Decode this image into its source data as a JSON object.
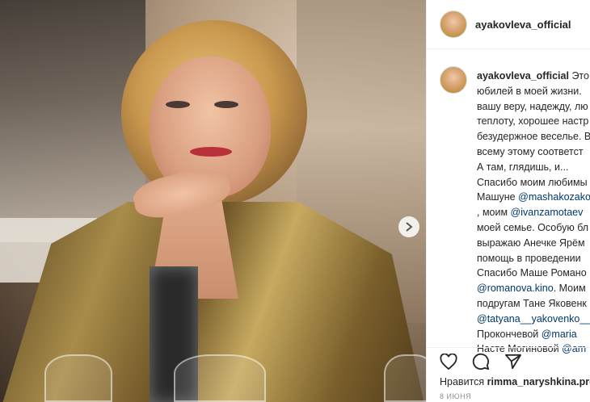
{
  "post": {
    "username": "ayakovleva_official",
    "caption_lines": [
      {
        "user": "ayakovleva_official",
        "text": " Это"
      },
      {
        "text": "юбилей в моей жизни."
      },
      {
        "text": "вашу веру, надежду, лю"
      },
      {
        "text": "теплоту, хорошее настр"
      },
      {
        "text": "безудержное веселье. В"
      },
      {
        "text": "всему этому соответст"
      },
      {
        "text": "А там, глядишь, и..."
      },
      {
        "text": "Спасибо моим любимы"
      },
      {
        "text": "Машуне ",
        "mention": "@mashakozako"
      },
      {
        "mention": "@ivanzamotaev",
        "text": " , моим "
      },
      {
        "text": "моей семье. Особую бл"
      },
      {
        "text": "выражаю Анечке Ярём"
      },
      {
        "text": "помощь в проведении"
      },
      {
        "text": "Спасибо Маше Романо"
      },
      {
        "mention": "@romanova.kino",
        "text": ". Моим"
      },
      {
        "text": "подругам Тане Яковенк"
      },
      {
        "mention": "@tatyana__yakovenko__"
      },
      {
        "text": "Прокончевой ",
        "mention": "@maria"
      },
      {
        "text": "Насте Могиновой ",
        "mention": "@am"
      }
    ],
    "likes_prefix": "Нравится ",
    "likes_user": "rimma_naryshkina.pro",
    "date": "8 ИЮНЯ"
  },
  "icons": {
    "like": "heart-icon",
    "comment": "comment-icon",
    "share": "share-icon",
    "next": "chevron-right-icon"
  },
  "colors": {
    "mention": "#00376b",
    "text": "#262626",
    "muted": "#8e8e8e"
  }
}
